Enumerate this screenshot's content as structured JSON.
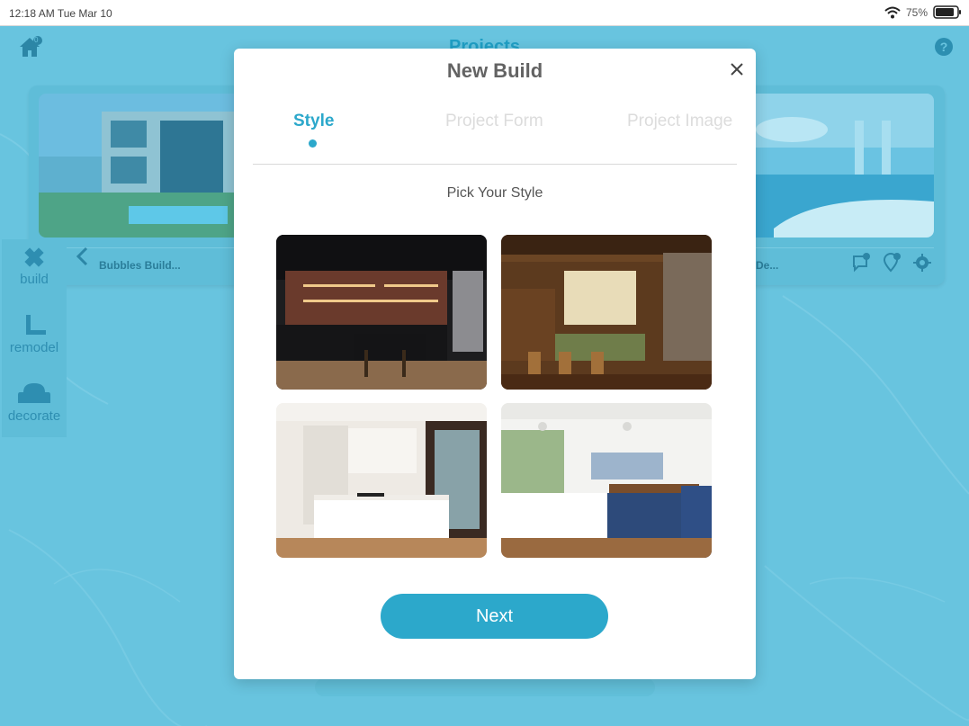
{
  "status_bar": {
    "time": "12:18 AM Tue Mar 10",
    "battery": "75%"
  },
  "app": {
    "title": "Projects",
    "cards": [
      {
        "title": "Bubbles Build..."
      },
      {
        "title": "s De..."
      }
    ],
    "card_badges": {
      "comments": "1",
      "notifications": "10"
    },
    "home_badge": "0",
    "sidebar": [
      {
        "label": "build",
        "icon": "build-icon"
      },
      {
        "label": "remodel",
        "icon": "remodel-icon"
      },
      {
        "label": "decorate",
        "icon": "decorate-icon"
      }
    ]
  },
  "modal": {
    "title": "New Build",
    "tabs": [
      {
        "label": "Style",
        "active": true
      },
      {
        "label": "Project Form",
        "active": false
      },
      {
        "label": "Project Image",
        "active": false
      }
    ],
    "subtitle": "Pick Your Style",
    "styles": [
      {
        "name": "industrial-kitchen"
      },
      {
        "name": "rustic-kitchen"
      },
      {
        "name": "modern-minimal-kitchen"
      },
      {
        "name": "farmhouse-white-kitchen"
      }
    ],
    "next_label": "Next"
  },
  "colors": {
    "accent": "#2ca8cb",
    "background": "#68c4df",
    "inactive_tab": "#dcdcdc"
  }
}
